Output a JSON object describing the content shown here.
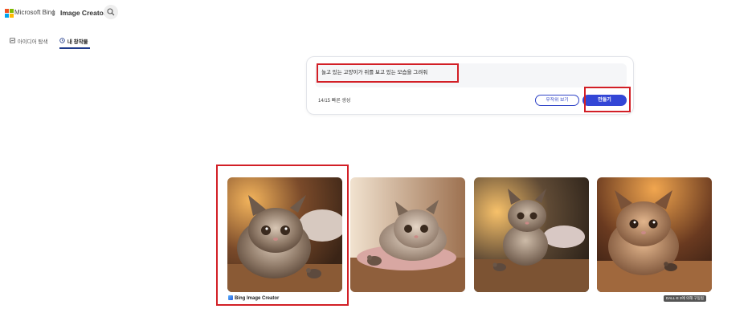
{
  "header": {
    "brand": "Microsoft Bing",
    "product": "Image Creator",
    "logo_colors": [
      "#f25022",
      "#7fba00",
      "#00a4ef",
      "#ffb900"
    ],
    "search_icon": "search-icon"
  },
  "tabs": [
    {
      "label": "아이디어 탐색",
      "icon": "explore-icon",
      "active": false
    },
    {
      "label": "내 창작물",
      "icon": "history-icon",
      "active": true
    }
  ],
  "prompt": {
    "text": "놀고 있는 고양이가 쥐를 보고 있는 모습을 그려줘",
    "boosts": "14/15 빠른 생성",
    "surprise_label": "무작위 보기",
    "create_label": "만들기"
  },
  "results": {
    "images": [
      {
        "alt": "cat image 1",
        "icon": "cat-photo"
      },
      {
        "alt": "cat image 2",
        "icon": "cat-photo"
      },
      {
        "alt": "cat image 3",
        "icon": "cat-photo"
      },
      {
        "alt": "cat image 4",
        "icon": "cat-photo"
      }
    ],
    "credit": "Bing Image Creator",
    "dalle_badge": "DALL·E 3에 의해 구동됨"
  },
  "colors": {
    "accent": "#3346d6",
    "highlight": "#d21f26"
  }
}
